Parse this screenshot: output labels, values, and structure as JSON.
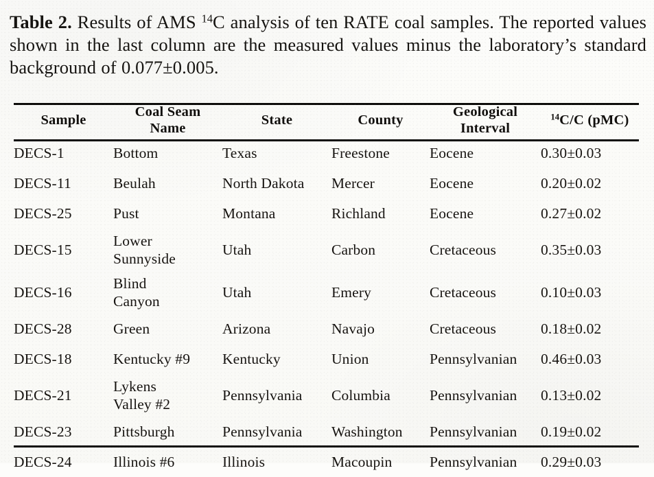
{
  "caption": {
    "label": "Table",
    "number": "2.",
    "text_part1": " Results of AMS ",
    "superscript": "14",
    "text_part2": "C analysis of ten RATE coal samples. The reported values shown in the last column are the measured values minus the laboratory’s standard background of 0.077±0.005."
  },
  "table": {
    "columns": [
      {
        "key": "sample",
        "header": "Sample",
        "header_line2": ""
      },
      {
        "key": "seam",
        "header": "Coal Seam",
        "header_line2": "Name"
      },
      {
        "key": "state",
        "header": "State",
        "header_line2": ""
      },
      {
        "key": "county",
        "header": "County",
        "header_line2": ""
      },
      {
        "key": "geo",
        "header": "Geological",
        "header_line2": "Interval"
      },
      {
        "key": "pmc",
        "header_sup": "14",
        "header": "C/C (pMC)",
        "header_line2": ""
      }
    ],
    "rows": [
      {
        "sample": "DECS-1",
        "seam_line1": "Bottom",
        "seam_line2": "",
        "state": "Texas",
        "county": "Freestone",
        "geo": "Eocene",
        "pmc": "0.30±0.03"
      },
      {
        "sample": "DECS-11",
        "seam_line1": "Beulah",
        "seam_line2": "",
        "state": "North Dakota",
        "county": "Mercer",
        "geo": "Eocene",
        "pmc": "0.20±0.02"
      },
      {
        "sample": "DECS-25",
        "seam_line1": "Pust",
        "seam_line2": "",
        "state": "Montana",
        "county": "Richland",
        "geo": "Eocene",
        "pmc": "0.27±0.02"
      },
      {
        "sample": "DECS-15",
        "seam_line1": "Lower",
        "seam_line2": "Sunnyside",
        "state": "Utah",
        "county": "Carbon",
        "geo": "Cretaceous",
        "pmc": "0.35±0.03"
      },
      {
        "sample": "DECS-16",
        "seam_line1": "Blind",
        "seam_line2": "Canyon",
        "state": "Utah",
        "county": "Emery",
        "geo": "Cretaceous",
        "pmc": "0.10±0.03"
      },
      {
        "sample": "DECS-28",
        "seam_line1": "Green",
        "seam_line2": "",
        "state": "Arizona",
        "county": "Navajo",
        "geo": "Cretaceous",
        "pmc": "0.18±0.02"
      },
      {
        "sample": "DECS-18",
        "seam_line1": "Kentucky #9",
        "seam_line2": "",
        "state": "Kentucky",
        "county": "Union",
        "geo": "Pennsylvanian",
        "pmc": "0.46±0.03"
      },
      {
        "sample": "DECS-21",
        "seam_line1": "Lykens",
        "seam_line2": "Valley #2",
        "state": "Pennsylvania",
        "county": "Columbia",
        "geo": "Pennsylvanian",
        "pmc": "0.13±0.02"
      },
      {
        "sample": "DECS-23",
        "seam_line1": "Pittsburgh",
        "seam_line2": "",
        "state": "Pennsylvania",
        "county": "Washington",
        "geo": "Pennsylvanian",
        "pmc": "0.19±0.02"
      },
      {
        "sample": "DECS-24",
        "seam_line1": "Illinois #6",
        "seam_line2": "",
        "state": "Illinois",
        "county": "Macoupin",
        "geo": "Pennsylvanian",
        "pmc": "0.29±0.03"
      }
    ]
  },
  "colors": {
    "ink": "#151310",
    "paper": "#fdfdfb",
    "rule": "#0d0c0a"
  }
}
